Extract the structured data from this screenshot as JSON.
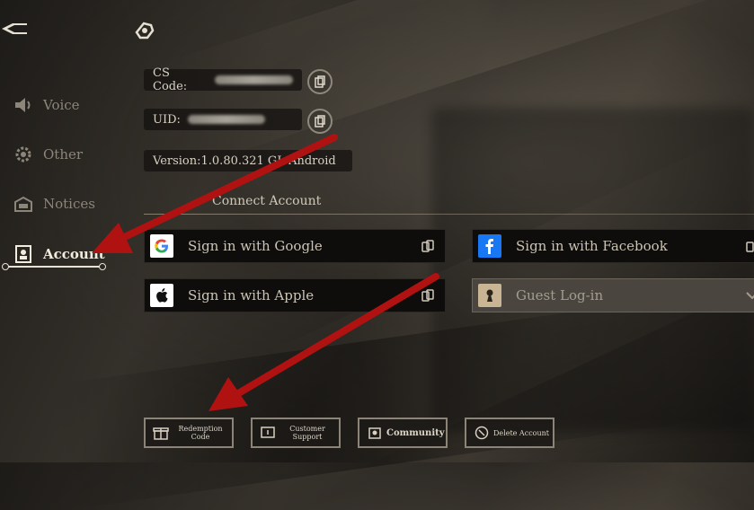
{
  "sidebar": {
    "items": [
      {
        "label": "Voice",
        "icon": "speaker-icon"
      },
      {
        "label": "Other",
        "icon": "gear-icon"
      },
      {
        "label": "Notices",
        "icon": "mailbox-icon"
      },
      {
        "label": "Account",
        "icon": "account-icon"
      }
    ],
    "active": "Account"
  },
  "info": {
    "cs_code_label": "CS Code:",
    "uid_label": "UID:",
    "version": "Version:1.0.80.321 GL Android"
  },
  "connect": {
    "title": "Connect Account",
    "google": "Sign in with Google",
    "facebook": "Sign in with Facebook",
    "apple": "Sign in with Apple",
    "guest": "Guest Log-in"
  },
  "footer": {
    "redemption": "Redemption Code",
    "support": "Customer Support",
    "community": "Community",
    "delete": "Delete Account"
  },
  "colors": {
    "arrow": "#b01212",
    "google_blue": "#4285f4",
    "facebook_blue": "#1877f2"
  }
}
